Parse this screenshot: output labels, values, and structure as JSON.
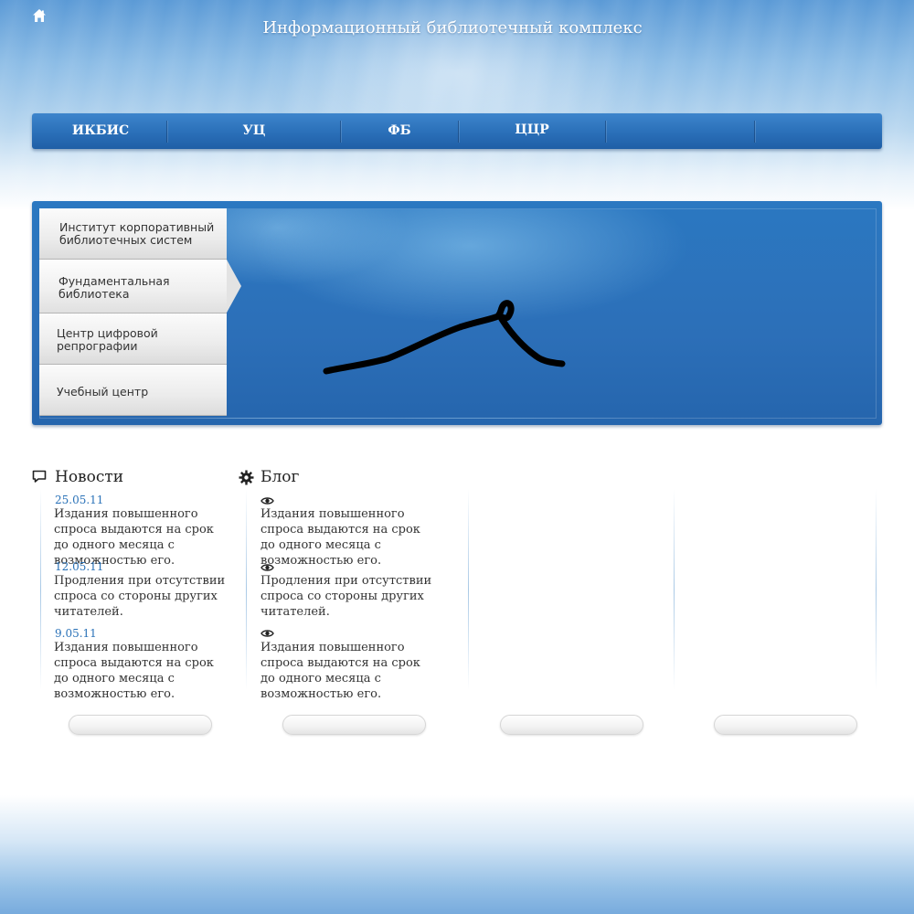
{
  "header": {
    "title": "Информационный библиотечный комплекс",
    "home_icon": "home-icon"
  },
  "topnav": {
    "items": [
      {
        "label": "ИКБИС"
      },
      {
        "label": "УЦ"
      },
      {
        "label": "ФБ"
      },
      {
        "label": "ЦЦР"
      },
      {
        "label": ""
      },
      {
        "label": ""
      }
    ]
  },
  "slider": {
    "tabs": [
      {
        "label": "Институт корпоративный\nбиблиотечных систем"
      },
      {
        "label": "Фундаментальная\nбиблиотека",
        "active": true
      },
      {
        "label": "Центр цифровой\n репрографии"
      },
      {
        "label": "Учебный центр"
      }
    ]
  },
  "news": {
    "title": "Новости",
    "icon": "speech-bubble-icon",
    "items": [
      {
        "date": "25.05.11",
        "text": "Издания повышенного спроса выдаются на срок до одного месяца с возможностью его."
      },
      {
        "date": "12.05.11",
        "text": "Продления при отсутствии спроса со стороны других читателей."
      },
      {
        "date": "9.05.11",
        "text": "Издания повышенного спроса выдаются на срок до одного месяца с возможностью его."
      }
    ]
  },
  "blog": {
    "title": "Блог",
    "icon": "gear-icon",
    "items": [
      {
        "icon": "eye-icon",
        "text": "Издания повышенного спроса выдаются на срок до одного месяца с возможностью его."
      },
      {
        "icon": "eye-icon",
        "text": "Продления при отсутствии спроса со стороны других читателей."
      },
      {
        "icon": "eye-icon",
        "text": "Издания повышенного спроса выдаются на срок до одного месяца с возможностью его."
      }
    ]
  },
  "colors": {
    "nav_blue": "#2a6fb8",
    "link_blue": "#2a72b8",
    "text": "#333333"
  }
}
